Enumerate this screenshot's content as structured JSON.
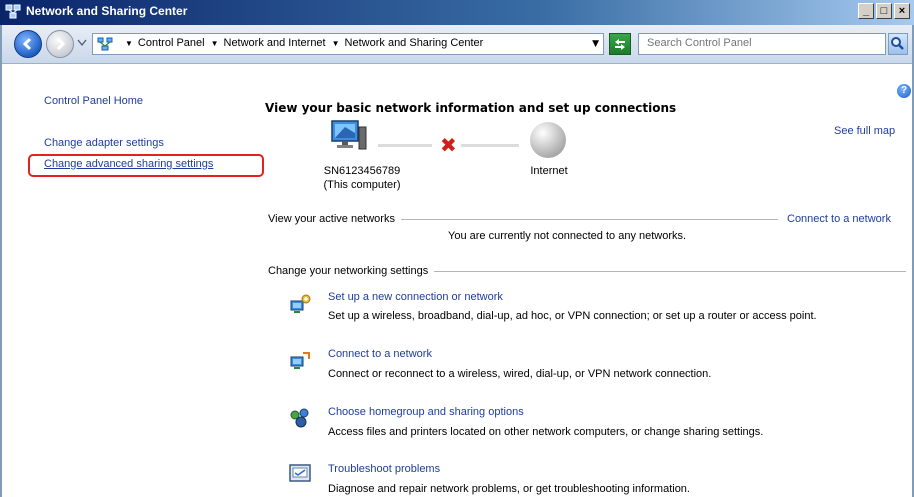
{
  "window": {
    "title": "Network and Sharing Center",
    "btn_min": "_",
    "btn_max": "□",
    "btn_close": "×"
  },
  "address": {
    "crumbs": [
      "Control Panel",
      "Network and Internet",
      "Network and Sharing Center"
    ],
    "search_placeholder": "Search Control Panel"
  },
  "help": "?",
  "sidebar": {
    "home": "Control Panel Home",
    "adapter": "Change adapter settings",
    "advanced": "Change advanced sharing settings"
  },
  "main": {
    "heading": "View your basic network information and set up connections",
    "see_full_map": "See full map",
    "map": {
      "computer_name": "SN6123456789",
      "computer_sub": "(This computer)",
      "internet": "Internet",
      "status_mark": "✖"
    },
    "active": {
      "label": "View your active networks",
      "connect_link": "Connect to a network",
      "status": "You are currently not connected to any networks."
    },
    "settings_label": "Change your networking settings",
    "tasks": [
      {
        "title": "Set up a new connection or network",
        "desc": "Set up a wireless, broadband, dial-up, ad hoc, or VPN connection; or set up a router or access point.",
        "icon": "new-connection-icon"
      },
      {
        "title": "Connect to a network",
        "desc": "Connect or reconnect to a wireless, wired, dial-up, or VPN network connection.",
        "icon": "connect-network-icon"
      },
      {
        "title": "Choose homegroup and sharing options",
        "desc": "Access files and printers located on other network computers, or change sharing settings.",
        "icon": "homegroup-icon"
      },
      {
        "title": "Troubleshoot problems",
        "desc": "Diagnose and repair network problems, or get troubleshooting information.",
        "icon": "troubleshoot-icon"
      }
    ]
  }
}
